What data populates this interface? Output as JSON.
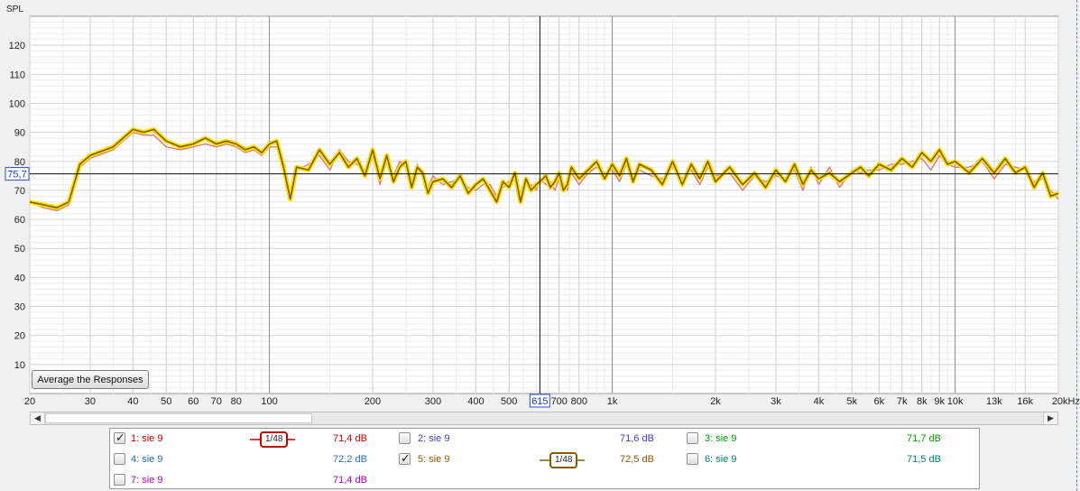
{
  "chart_data": {
    "type": "line",
    "title": "",
    "ylabel": "SPL",
    "xlabel": "",
    "xscale": "log",
    "xlim": [
      20,
      20000
    ],
    "ylim": [
      0,
      130
    ],
    "y_ticks": [
      10,
      20,
      30,
      40,
      50,
      60,
      70,
      80,
      90,
      100,
      110,
      120
    ],
    "y_tick_labels": [
      "10",
      "20",
      "30",
      "40",
      "50",
      "60",
      "70",
      "80",
      "90",
      "100",
      "110",
      "120"
    ],
    "x_ticks": [
      20,
      30,
      40,
      50,
      60,
      70,
      80,
      100,
      200,
      300,
      400,
      500,
      700,
      800,
      1000,
      2000,
      3000,
      4000,
      5000,
      6000,
      7000,
      8000,
      9000,
      10000,
      13000,
      16000,
      20000
    ],
    "x_tick_labels": [
      "20",
      "30",
      "40",
      "50",
      "60",
      "70",
      "80",
      "100",
      "200",
      "300",
      "400",
      "500",
      "700",
      "800",
      "1k",
      "2k",
      "3k",
      "4k",
      "5k",
      "6k",
      "7k",
      "8k",
      "9k",
      "10k",
      "13k",
      "16k",
      "20kHz"
    ],
    "cursor": {
      "x_label": "615",
      "x_value": 615,
      "y_label": "75,7",
      "y_value": 75.7
    },
    "grid": true,
    "series": [
      {
        "name": "5: sie 9",
        "color": "#8a5a00",
        "highlight": "#f5e000",
        "x": [
          20,
          22,
          24,
          26,
          28,
          30,
          35,
          40,
          43,
          46,
          50,
          55,
          60,
          65,
          70,
          75,
          80,
          85,
          90,
          95,
          100,
          105,
          110,
          115,
          120,
          130,
          140,
          150,
          160,
          170,
          180,
          190,
          200,
          210,
          220,
          230,
          240,
          250,
          260,
          270,
          280,
          290,
          300,
          320,
          340,
          360,
          380,
          400,
          420,
          440,
          460,
          480,
          500,
          520,
          540,
          560,
          580,
          600,
          615,
          640,
          660,
          680,
          700,
          720,
          740,
          760,
          800,
          850,
          900,
          950,
          1000,
          1050,
          1100,
          1150,
          1200,
          1300,
          1400,
          1500,
          1600,
          1700,
          1800,
          1900,
          2000,
          2200,
          2400,
          2600,
          2800,
          3000,
          3200,
          3400,
          3600,
          3800,
          4000,
          4300,
          4600,
          5000,
          5300,
          5600,
          6000,
          6500,
          7000,
          7500,
          8000,
          8500,
          9000,
          9500,
          10000,
          11000,
          12000,
          13000,
          14000,
          15000,
          16000,
          17000,
          18000,
          19000,
          20000
        ],
        "y": [
          66,
          65,
          64,
          66,
          79,
          82,
          85,
          91,
          90,
          91,
          87,
          85,
          86,
          88,
          86,
          87,
          86,
          84,
          85,
          83,
          86,
          87,
          78,
          67,
          78,
          77,
          84,
          79,
          83,
          78,
          81,
          75,
          84,
          74,
          82,
          73,
          78,
          80,
          71,
          78,
          76,
          69,
          73,
          74,
          71,
          75,
          69,
          72,
          74,
          70,
          66,
          73,
          71,
          76,
          66,
          74,
          70,
          72,
          73,
          75,
          71,
          73,
          76,
          70,
          72,
          78,
          74,
          77,
          80,
          74,
          79,
          75,
          81,
          73,
          79,
          77,
          72,
          80,
          72,
          79,
          74,
          80,
          73,
          78,
          72,
          76,
          71,
          77,
          73,
          79,
          72,
          77,
          74,
          76,
          73,
          76,
          78,
          75,
          79,
          77,
          81,
          78,
          83,
          80,
          84,
          79,
          80,
          76,
          81,
          76,
          81,
          76,
          78,
          71,
          76,
          68,
          69
        ]
      },
      {
        "name": "1: sie 9",
        "color": "#d88080",
        "x": [
          20,
          22,
          24,
          26,
          28,
          30,
          35,
          40,
          43,
          46,
          50,
          55,
          60,
          65,
          70,
          75,
          80,
          85,
          90,
          95,
          100,
          105,
          110,
          115,
          120,
          130,
          140,
          150,
          160,
          170,
          180,
          190,
          200,
          210,
          220,
          230,
          240,
          250,
          260,
          270,
          280,
          290,
          300,
          320,
          340,
          360,
          380,
          400,
          420,
          440,
          460,
          480,
          500,
          520,
          540,
          560,
          580,
          600,
          615,
          640,
          660,
          680,
          700,
          720,
          740,
          760,
          800,
          850,
          900,
          950,
          1000,
          1050,
          1100,
          1150,
          1200,
          1300,
          1400,
          1500,
          1600,
          1700,
          1800,
          1900,
          2000,
          2200,
          2400,
          2600,
          2800,
          3000,
          3200,
          3400,
          3600,
          3800,
          4000,
          4300,
          4600,
          5000,
          5300,
          5600,
          6000,
          6500,
          7000,
          7500,
          8000,
          8500,
          9000,
          9500,
          10000,
          11000,
          12000,
          13000,
          14000,
          15000,
          16000,
          17000,
          18000,
          19000,
          20000
        ],
        "y": [
          66,
          64,
          63,
          65,
          78,
          81,
          84,
          90,
          89,
          89,
          85,
          84,
          85,
          86,
          85,
          86,
          85,
          83,
          84,
          82,
          85,
          85,
          76,
          70,
          77,
          79,
          82,
          77,
          84,
          80,
          79,
          77,
          83,
          72,
          80,
          75,
          80,
          78,
          73,
          79,
          74,
          71,
          75,
          72,
          73,
          74,
          71,
          70,
          72,
          72,
          68,
          71,
          73,
          74,
          68,
          72,
          72,
          70,
          74,
          72,
          73,
          70,
          74,
          72,
          70,
          76,
          72,
          76,
          78,
          76,
          77,
          73,
          79,
          75,
          77,
          75,
          74,
          78,
          74,
          77,
          72,
          78,
          75,
          76,
          70,
          75,
          73,
          75,
          74,
          77,
          70,
          78,
          72,
          78,
          71,
          77,
          76,
          77,
          77,
          79,
          79,
          80,
          81,
          77,
          82,
          79,
          78,
          78,
          80,
          74,
          79,
          78,
          77,
          73,
          74,
          70,
          67
        ]
      }
    ]
  },
  "button": {
    "average_label": "Average the Responses"
  },
  "legend": {
    "items": [
      {
        "label": "1: sie 9",
        "value": "71,4 dB",
        "checked": true,
        "color": "#c00000",
        "smoothing": "1/48"
      },
      {
        "label": "2: sie 9",
        "value": "71,6 dB",
        "checked": false,
        "color": "#4040c0"
      },
      {
        "label": "3: sie 9",
        "value": "71,7 dB",
        "checked": false,
        "color": "#00a000"
      },
      {
        "label": "4: sie 9",
        "value": "72,2 dB",
        "checked": false,
        "color": "#2070b0"
      },
      {
        "label": "5: sie 9",
        "value": "72,5 dB",
        "checked": true,
        "color": "#8a5a00",
        "smoothing": "1/48"
      },
      {
        "label": "6: sie 9",
        "value": "71,5 dB",
        "checked": false,
        "color": "#008080"
      },
      {
        "label": "7: sie 9",
        "value": "71,4 dB",
        "checked": false,
        "color": "#b000b0"
      }
    ]
  }
}
